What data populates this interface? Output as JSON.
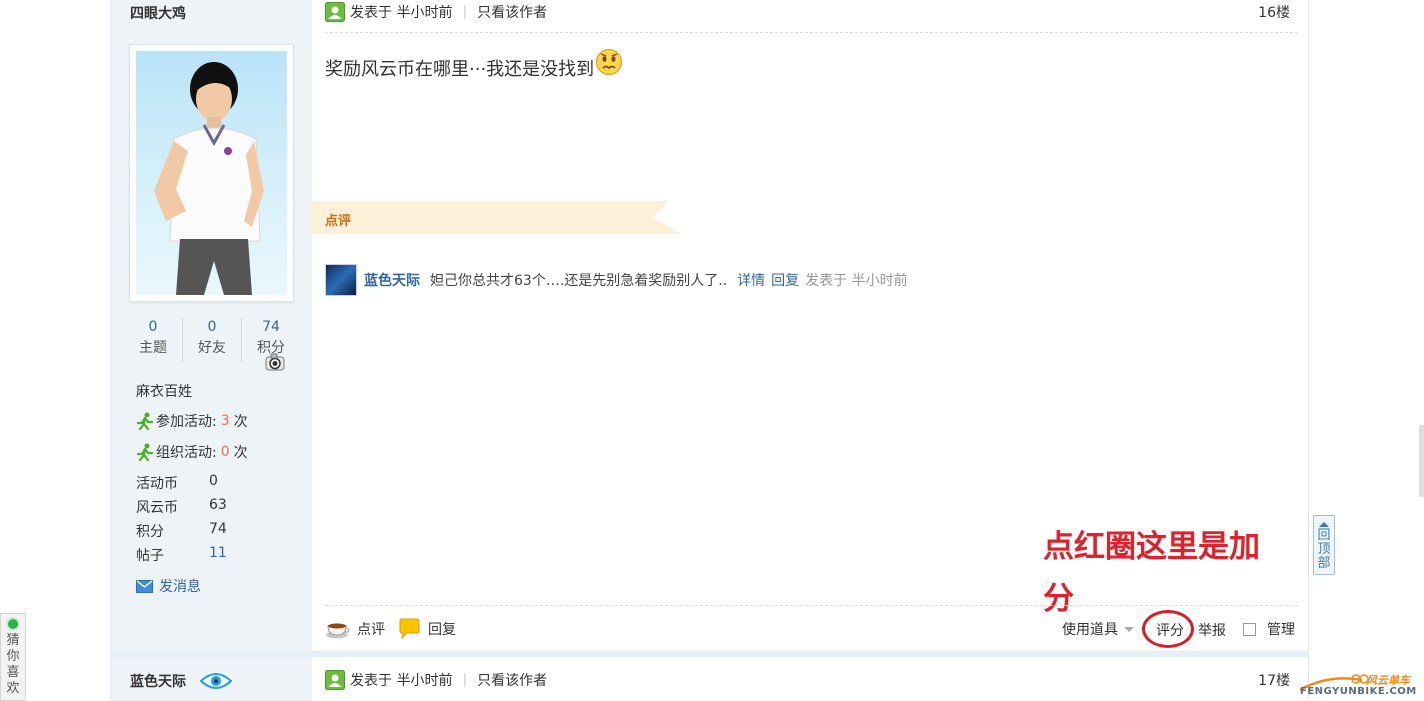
{
  "post": {
    "author": "四眼大鸡",
    "stats": [
      {
        "num": "0",
        "label": "主题"
      },
      {
        "num": "0",
        "label": "好友"
      },
      {
        "num": "74",
        "label": "积分"
      }
    ],
    "rank": "麻衣百姓",
    "activities": [
      {
        "label": "参加活动:",
        "count": "3",
        "unit": "次"
      },
      {
        "label": "组织活动:",
        "count": "0",
        "unit": "次"
      }
    ],
    "profile": [
      {
        "k": "活动币",
        "v": "0"
      },
      {
        "k": "风云币",
        "v": "63"
      },
      {
        "k": "积分",
        "v": "74"
      },
      {
        "k": "帖子",
        "v": "11"
      }
    ],
    "send_message": "发消息",
    "posted_at": "发表于 半小时前",
    "only_author": "只看该作者",
    "floor": "16楼",
    "content": "奖励风云币在哪里···我还是没找到",
    "comment_section_label": "点评",
    "comment": {
      "user": "蓝色天际",
      "text": "妲己你总共才63个….还是先别急着奖励别人了..",
      "detail": "详情",
      "reply": "回复",
      "posted": "发表于 半小时前"
    },
    "actions": {
      "comment": "点评",
      "reply": "回复",
      "use_tools": "使用道具",
      "rate": "评分",
      "report": "举报",
      "manage": "管理"
    },
    "annotation": "点红圈这里是加分"
  },
  "next_post": {
    "author": "蓝色天际",
    "posted_at": "发表于 半小时前",
    "only_author": "只看该作者",
    "floor": "17楼"
  },
  "back_to_top": [
    "回",
    "顶",
    "部"
  ],
  "guess_like": [
    "猜",
    "你",
    "喜",
    "欢"
  ],
  "logo": {
    "name": "风云单车",
    "domain": "FENGYUNBIKE.COM"
  },
  "colors": {
    "link": "#336699",
    "annotation": "#e0202a",
    "orange": "#f26c4f"
  }
}
